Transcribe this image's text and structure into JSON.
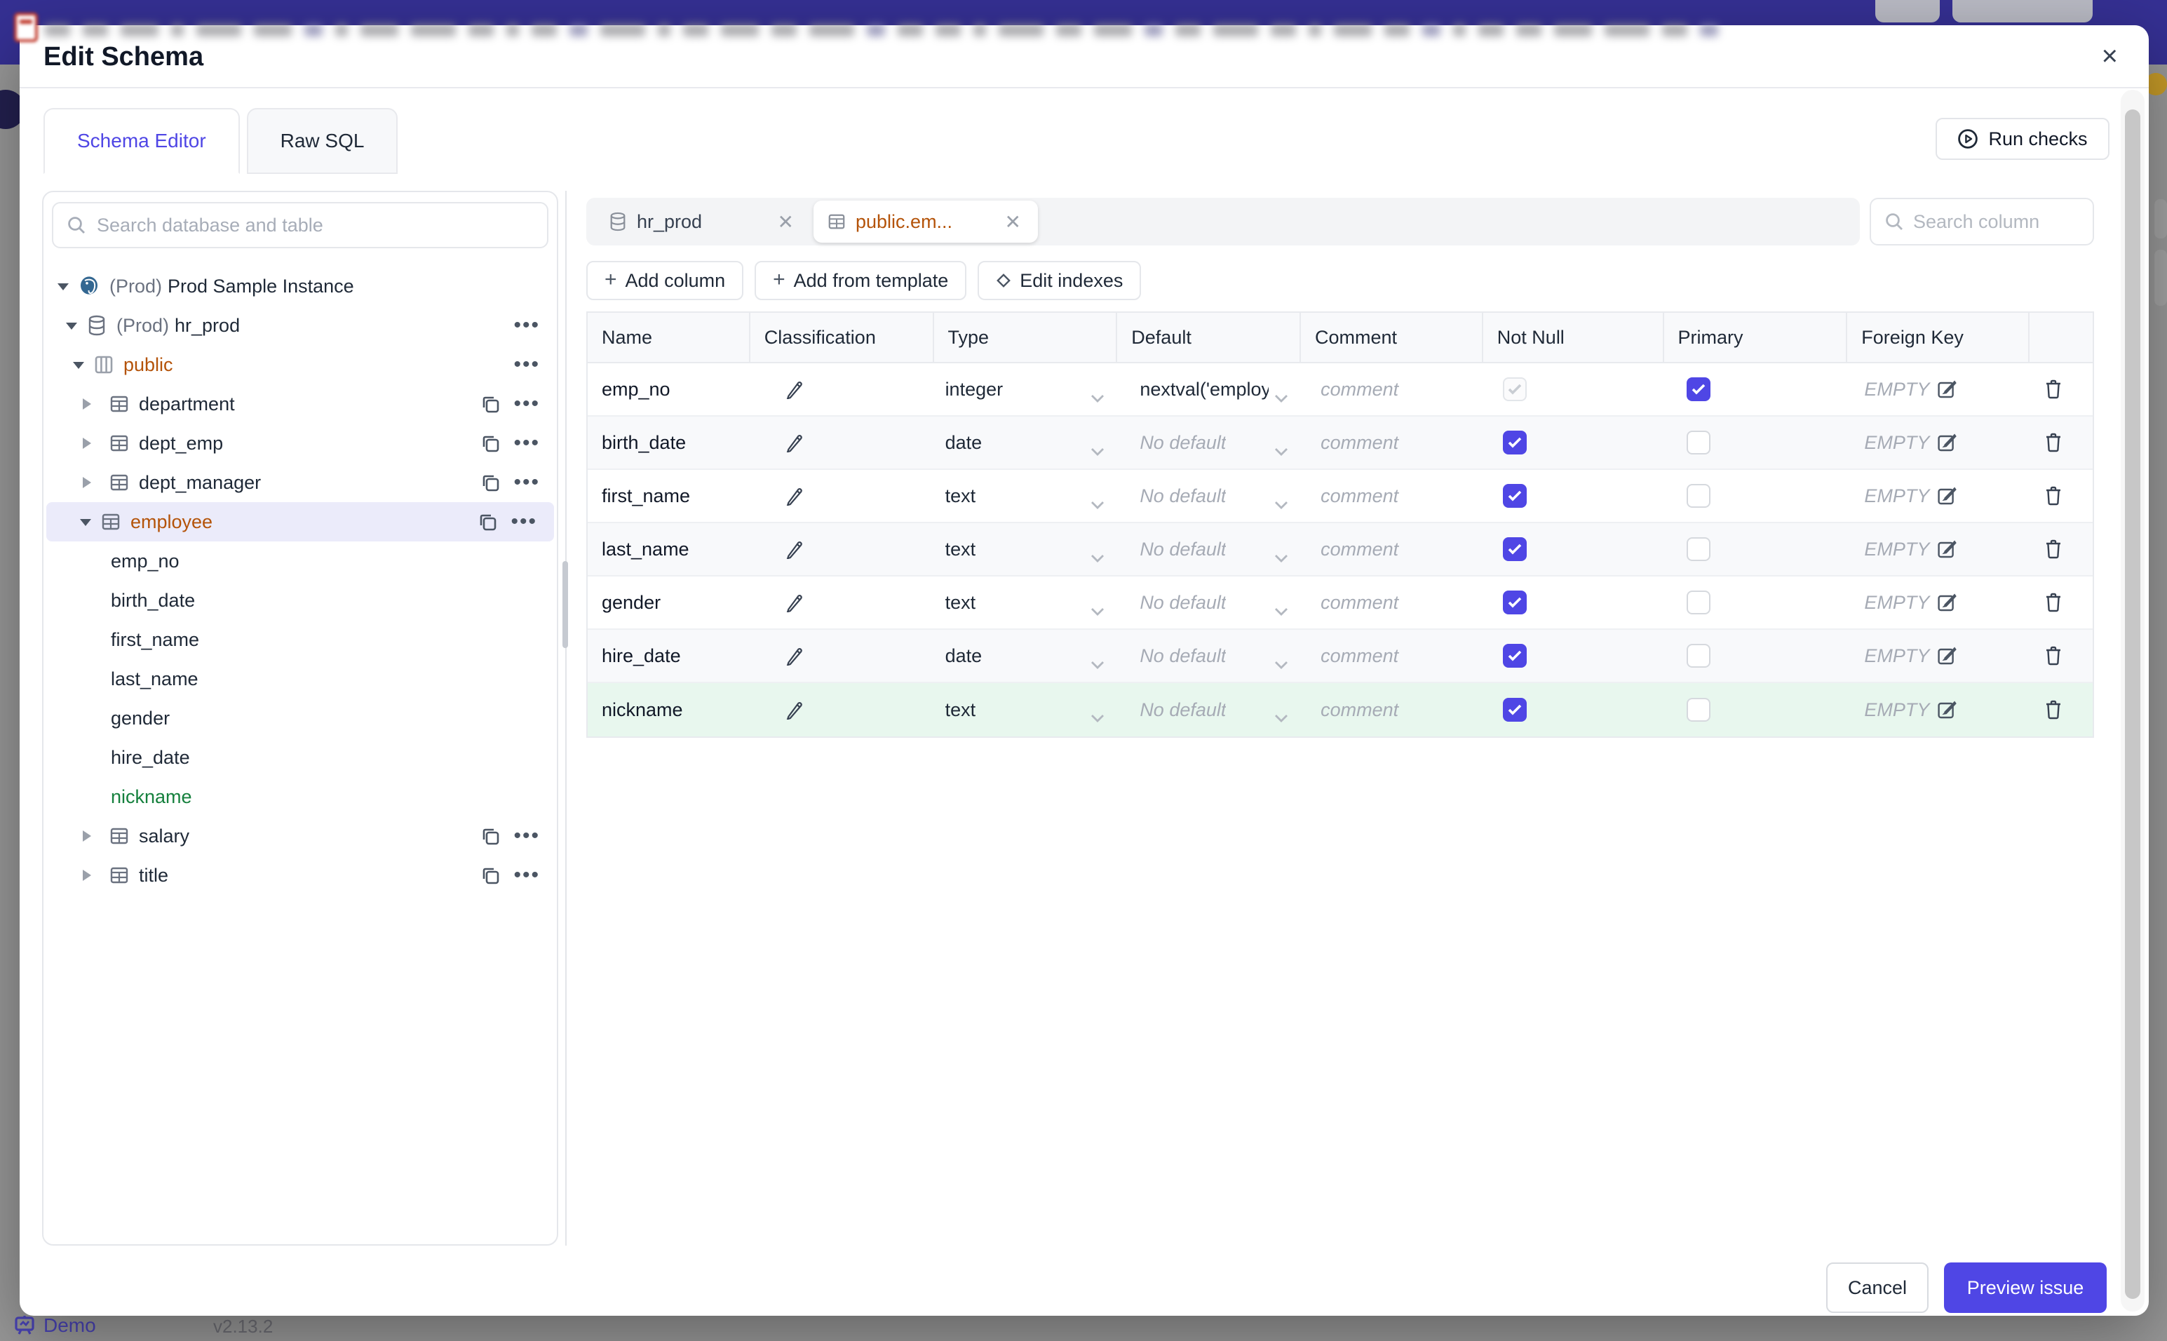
{
  "modal": {
    "title": "Edit Schema",
    "close_icon": "×"
  },
  "tabs": [
    {
      "label": "Schema Editor",
      "active": true
    },
    {
      "label": "Raw SQL",
      "active": false
    }
  ],
  "run_checks": {
    "label": "Run checks"
  },
  "sidebar": {
    "search_placeholder": "Search database and table",
    "tree": [
      {
        "prefix": "(Prod)",
        "label": "Prod Sample Instance",
        "type": "instance",
        "expanded": true
      },
      {
        "prefix": "(Prod)",
        "label": "hr_prod",
        "type": "database",
        "expanded": true
      },
      {
        "label": "public",
        "type": "schema",
        "expanded": true
      },
      {
        "label": "department",
        "type": "table",
        "expanded": false
      },
      {
        "label": "dept_emp",
        "type": "table",
        "expanded": false
      },
      {
        "label": "dept_manager",
        "type": "table",
        "expanded": false
      },
      {
        "label": "employee",
        "type": "table",
        "expanded": true,
        "selected": true
      },
      {
        "label": "emp_no",
        "type": "column"
      },
      {
        "label": "birth_date",
        "type": "column"
      },
      {
        "label": "first_name",
        "type": "column"
      },
      {
        "label": "last_name",
        "type": "column"
      },
      {
        "label": "gender",
        "type": "column"
      },
      {
        "label": "hire_date",
        "type": "column"
      },
      {
        "label": "nickname",
        "type": "column",
        "highlight": "green"
      },
      {
        "label": "salary",
        "type": "table",
        "expanded": false
      },
      {
        "label": "title",
        "type": "table",
        "expanded": false
      }
    ]
  },
  "editor": {
    "chips": [
      {
        "label": "hr_prod",
        "icon": "database"
      },
      {
        "label": "public.em...",
        "icon": "table",
        "active": true
      }
    ],
    "actions": [
      {
        "label": "Add column",
        "icon": "plus"
      },
      {
        "label": "Add from template",
        "icon": "plus"
      },
      {
        "label": "Edit indexes",
        "icon": "diamond"
      }
    ],
    "column_search_placeholder": "Search column"
  },
  "table": {
    "headers": [
      "Name",
      "Classification",
      "Type",
      "Default",
      "Comment",
      "Not Null",
      "Primary",
      "Foreign Key"
    ],
    "foreign_key_empty": "EMPTY",
    "comment_placeholder": "comment",
    "rows": [
      {
        "name": "emp_no",
        "type": "integer",
        "default": "nextval('employ",
        "default_is_placeholder": false,
        "not_null": "checked-disabled",
        "primary": true,
        "fk": "EMPTY",
        "comment": "comment"
      },
      {
        "name": "birth_date",
        "type": "date",
        "default": "No default",
        "default_is_placeholder": true,
        "not_null": "checked",
        "primary": false,
        "fk": "EMPTY",
        "comment": "comment"
      },
      {
        "name": "first_name",
        "type": "text",
        "default": "No default",
        "default_is_placeholder": true,
        "not_null": "checked",
        "primary": false,
        "fk": "EMPTY",
        "comment": "comment"
      },
      {
        "name": "last_name",
        "type": "text",
        "default": "No default",
        "default_is_placeholder": true,
        "not_null": "checked",
        "primary": false,
        "fk": "EMPTY",
        "comment": "comment"
      },
      {
        "name": "gender",
        "type": "text",
        "default": "No default",
        "default_is_placeholder": true,
        "not_null": "checked",
        "primary": false,
        "fk": "EMPTY",
        "comment": "comment"
      },
      {
        "name": "hire_date",
        "type": "date",
        "default": "No default",
        "default_is_placeholder": true,
        "not_null": "checked",
        "primary": false,
        "fk": "EMPTY",
        "comment": "comment"
      },
      {
        "name": "nickname",
        "type": "text",
        "default": "No default",
        "default_is_placeholder": true,
        "not_null": "checked",
        "primary": false,
        "fk": "EMPTY",
        "comment": "comment",
        "row_highlight": "green"
      }
    ]
  },
  "footer": {
    "cancel_label": "Cancel",
    "submit_label": "Preview issue"
  },
  "background": {
    "demo_label": "Demo",
    "version": "v2.13.2"
  },
  "colors": {
    "accent": "#4f46e5",
    "header_blue": "#353093",
    "selected_tree_row": "#ebebfa",
    "green_row": "#e8f7ee",
    "orange_text": "#b45309",
    "green_text": "#15803d",
    "gold_avatar": "#c79b28"
  }
}
